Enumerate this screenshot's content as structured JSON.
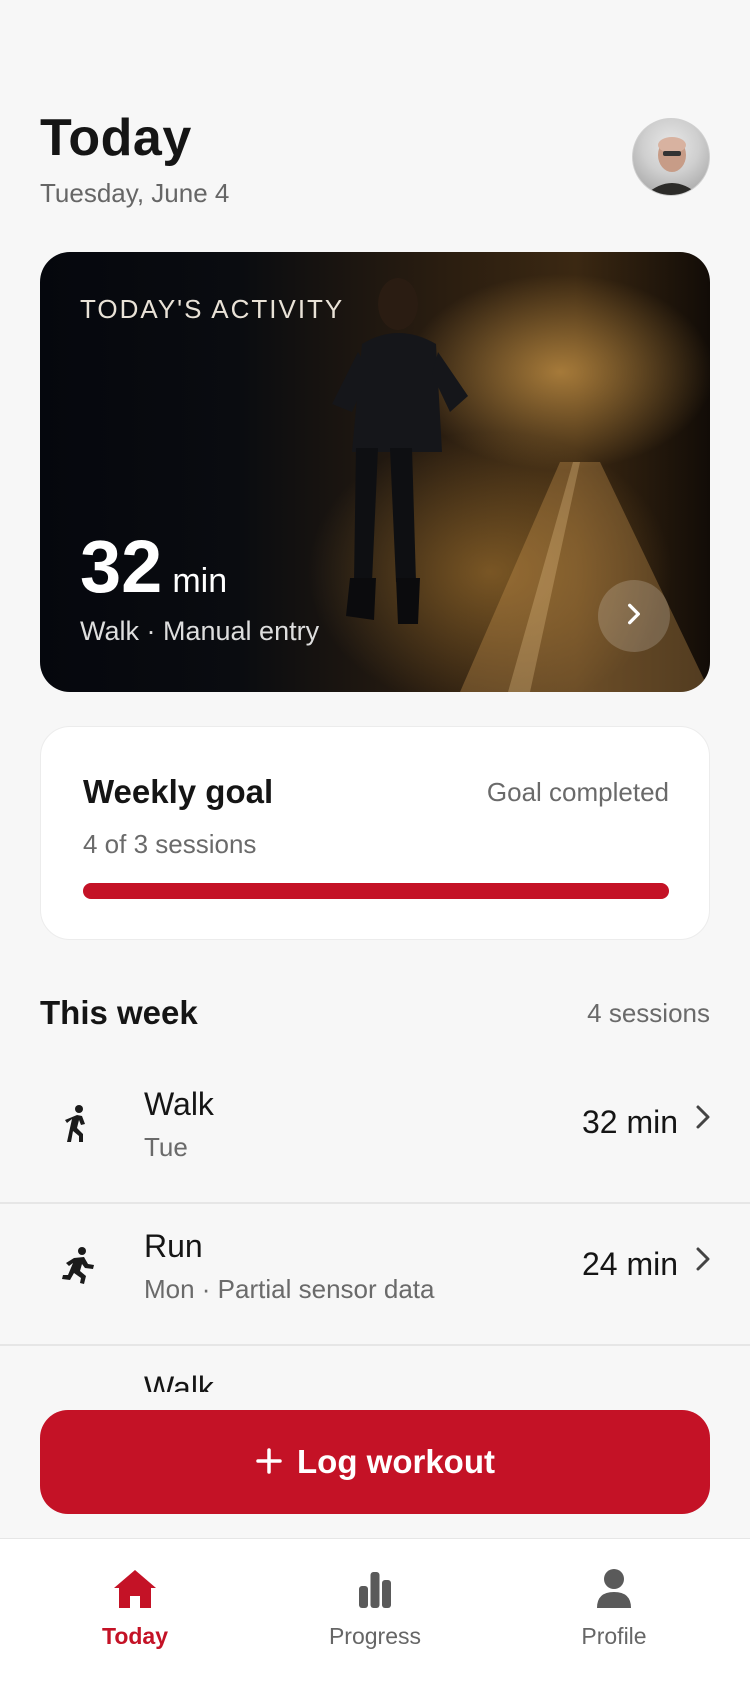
{
  "header": {
    "title": "Today",
    "date": "Tuesday, June 4"
  },
  "hero": {
    "kicker": "TODAY'S ACTIVITY",
    "value": "32",
    "unit": "min",
    "subtitle": "Walk · Manual entry"
  },
  "goal": {
    "title": "Weekly goal",
    "status": "Goal completed",
    "progress_text": "4 of 3 sessions",
    "progress_fraction": 1.0
  },
  "week": {
    "title": "This week",
    "count": "4 sessions",
    "items": [
      {
        "title": "Walk",
        "subtitle": "Tue",
        "value": "32 min",
        "icon": "walk-icon"
      },
      {
        "title": "Run",
        "subtitle": "Mon · Partial sensor data",
        "value": "24 min",
        "icon": "run-icon"
      },
      {
        "title": "Walk",
        "subtitle": "",
        "value": "",
        "icon": "walk-icon"
      }
    ]
  },
  "actions": {
    "log_label": "Log workout"
  },
  "nav": {
    "items": [
      {
        "label": "Today"
      },
      {
        "label": "Progress"
      },
      {
        "label": "Profile"
      }
    ]
  },
  "colors": {
    "accent": "#c41226",
    "background": "#f7f7f7",
    "muted_text": "#666666"
  }
}
